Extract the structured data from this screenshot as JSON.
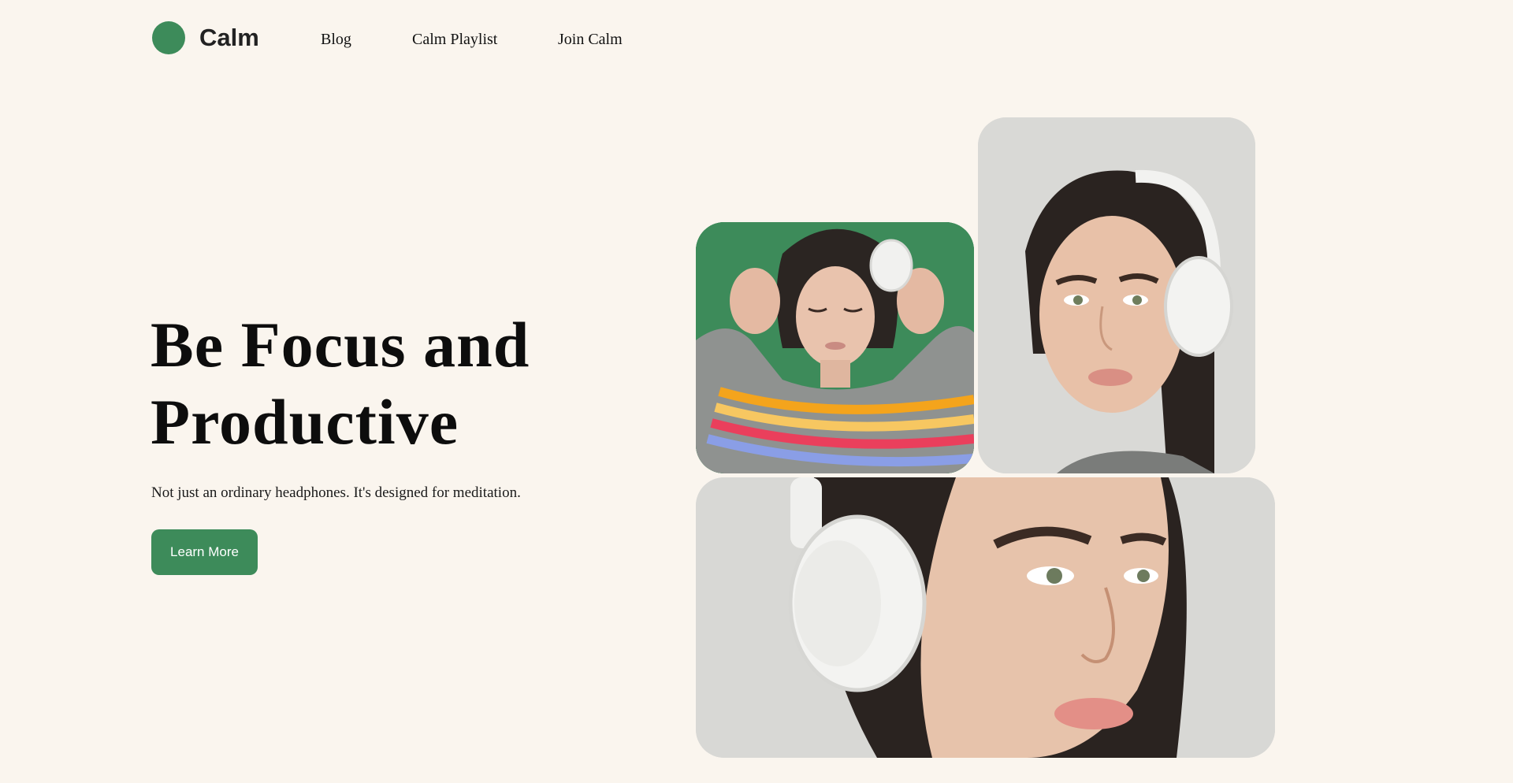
{
  "brand": {
    "name": "Calm",
    "color": "#3d8b5a"
  },
  "nav": {
    "items": [
      {
        "label": "Blog"
      },
      {
        "label": "Calm Playlist"
      },
      {
        "label": "Join Calm"
      }
    ]
  },
  "hero": {
    "title_line1": "Be Focus and",
    "title_line2": "Productive",
    "subtitle": "Not just an ordinary headphones. It's designed for meditation.",
    "cta_label": "Learn More"
  },
  "gallery": {
    "images": [
      {
        "icon": "woman-headphones-photo",
        "background": "#3d8b5a"
      },
      {
        "icon": "woman-headphones-portrait-photo",
        "background": "#d9d9d6"
      },
      {
        "icon": "woman-headphones-closeup-photo",
        "background": "#d8d8d5"
      }
    ]
  }
}
